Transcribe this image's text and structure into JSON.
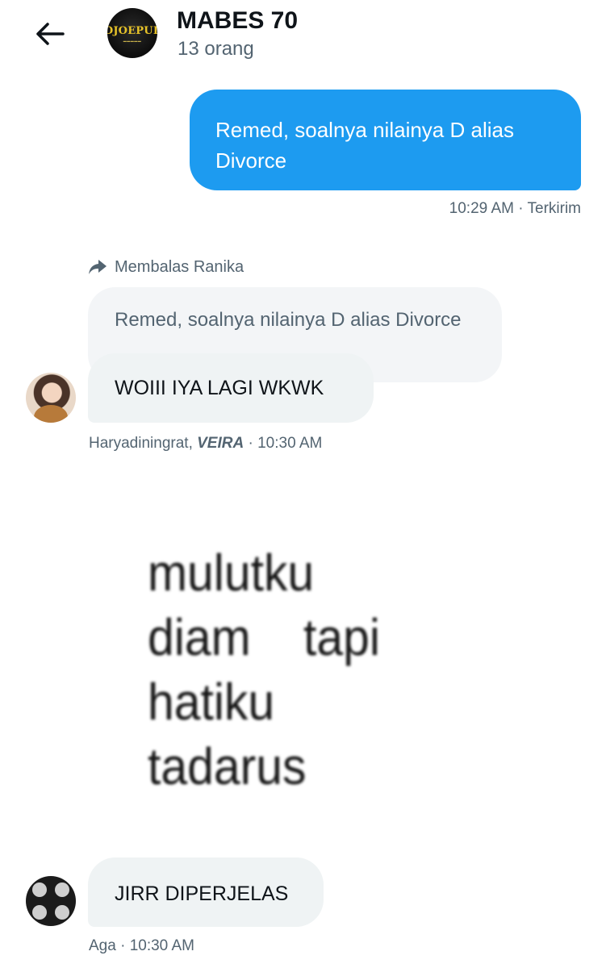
{
  "header": {
    "title": "MABES 70",
    "members": "13 orang",
    "avatar_text": "DJOEPUL",
    "back_icon": "arrow-left-icon"
  },
  "messages": [
    {
      "direction": "out",
      "text": "Remed, soalnya nilainya D alias Divorce",
      "time": "10:29 AM",
      "status": "Terkirim"
    },
    {
      "direction": "in",
      "reply_label": "Membalas Ranika",
      "quoted_text": "Remed, soalnya nilainya D alias Divorce",
      "text": "WOIII IYA LAGI WKWK",
      "sender": "Haryadiningrat,",
      "sender_bold": "VEIRA",
      "time": "10:30 AM"
    },
    {
      "direction": "in",
      "type": "image",
      "image_text": "mulutku\ndiam    tapi\nhatiku\ntadarus"
    },
    {
      "direction": "in",
      "text": "JIRR DIPERJELAS",
      "sender": "Aga",
      "time": "10:30 AM"
    }
  ],
  "colors": {
    "accent": "#1d9bf0",
    "bubble_in": "#eff3f4",
    "muted": "#536471"
  }
}
